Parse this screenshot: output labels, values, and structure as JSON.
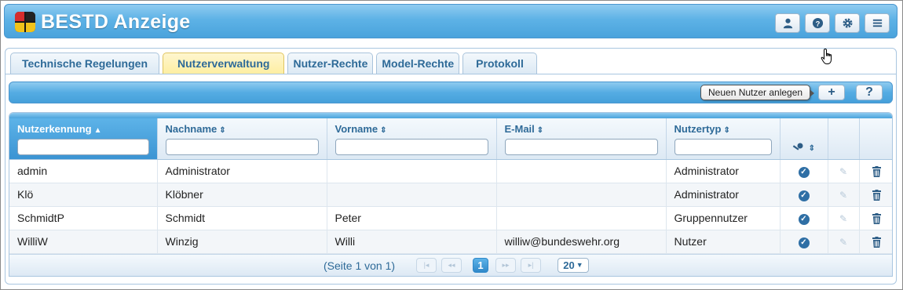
{
  "app": {
    "title": "BESTD Anzeige"
  },
  "header_buttons": [
    {
      "icon": "user-icon"
    },
    {
      "icon": "help-icon"
    },
    {
      "icon": "gear-icon"
    },
    {
      "icon": "menu-icon"
    }
  ],
  "tabs": [
    {
      "label": "Technische Regelungen",
      "active": false
    },
    {
      "label": "Nutzerverwaltung",
      "active": true
    },
    {
      "label": "Nutzer-Rechte",
      "active": false
    },
    {
      "label": "Model-Rechte",
      "active": false
    },
    {
      "label": "Protokoll",
      "active": false
    }
  ],
  "toolbar": {
    "tooltip": "Neuen Nutzer anlegen",
    "add_label": "+",
    "help_label": "?"
  },
  "table": {
    "columns": [
      {
        "label": "Nutzerkennung",
        "sort": "▲"
      },
      {
        "label": "Nachname",
        "sort": "⇕"
      },
      {
        "label": "Vorname",
        "sort": "⇕"
      },
      {
        "label": "E-Mail",
        "sort": "⇕"
      },
      {
        "label": "Nutzertyp",
        "sort": "⇕"
      },
      {
        "label": "",
        "sort": "⇕",
        "icon": "key-icon"
      },
      {
        "label": ""
      },
      {
        "label": ""
      }
    ],
    "rows": [
      {
        "kennung": "admin",
        "nachname": "Administrator",
        "vorname": "",
        "email": "",
        "typ": "Administrator"
      },
      {
        "kennung": "Klö",
        "nachname": "Klöbner",
        "vorname": "",
        "email": "",
        "typ": "Administrator"
      },
      {
        "kennung": "SchmidtP",
        "nachname": "Schmidt",
        "vorname": "Peter",
        "email": "",
        "typ": "Gruppennutzer"
      },
      {
        "kennung": "WilliW",
        "nachname": "Winzig",
        "vorname": "Willi",
        "email": "williw@bundeswehr.org",
        "typ": "Nutzer"
      }
    ]
  },
  "pager": {
    "info": "(Seite 1 von 1)",
    "current_page": "1",
    "page_size": "20"
  },
  "colors": {
    "accent": "#4aa3dc",
    "active_tab": "#fdeea2",
    "text_blue": "#2e6a98"
  }
}
